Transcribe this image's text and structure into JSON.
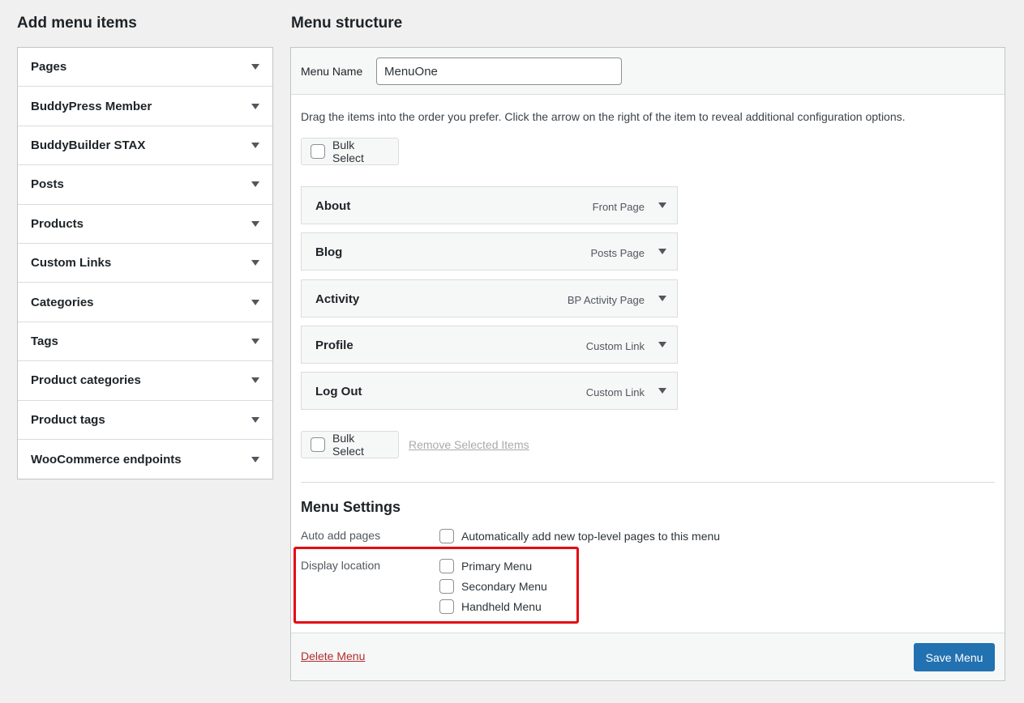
{
  "left": {
    "title": "Add menu items",
    "items": [
      {
        "label": "Pages"
      },
      {
        "label": "BuddyPress Member"
      },
      {
        "label": "BuddyBuilder STAX"
      },
      {
        "label": "Posts"
      },
      {
        "label": "Products"
      },
      {
        "label": "Custom Links"
      },
      {
        "label": "Categories"
      },
      {
        "label": "Tags"
      },
      {
        "label": "Product categories"
      },
      {
        "label": "Product tags"
      },
      {
        "label": "WooCommerce endpoints"
      }
    ]
  },
  "right": {
    "title": "Menu structure",
    "menu_name_label": "Menu Name",
    "menu_name_value": "MenuOne",
    "instructions": "Drag the items into the order you prefer. Click the arrow on the right of the item to reveal additional configuration options.",
    "bulk_select_label": "Bulk Select",
    "remove_selected_label": "Remove Selected Items",
    "menu_items": [
      {
        "title": "About",
        "type": "Front Page"
      },
      {
        "title": "Blog",
        "type": "Posts Page"
      },
      {
        "title": "Activity",
        "type": "BP Activity Page"
      },
      {
        "title": "Profile",
        "type": "Custom Link"
      },
      {
        "title": "Log Out",
        "type": "Custom Link"
      }
    ],
    "settings": {
      "title": "Menu Settings",
      "auto_add_label": "Auto add pages",
      "auto_add_option": "Automatically add new top-level pages to this menu",
      "display_location_label": "Display location",
      "locations": [
        "Primary Menu",
        "Secondary Menu",
        "Handheld Menu"
      ]
    },
    "delete_label": "Delete Menu",
    "save_label": "Save Menu"
  },
  "colors": {
    "accent": "#2271b1",
    "delete": "#b32d2e",
    "highlight": "#e50914"
  }
}
